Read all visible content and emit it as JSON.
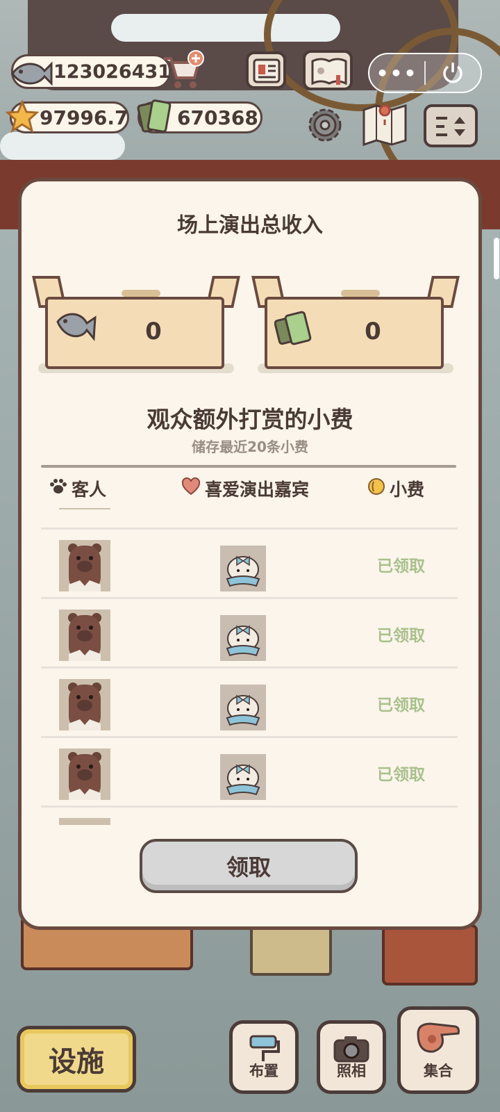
{
  "hud": {
    "fish_count": "123026431",
    "star_count": "97996.7",
    "ticket_count": "670368",
    "icons": [
      "fish-icon",
      "cart-plus-icon",
      "card-icon",
      "paw-book-icon",
      "more-icon",
      "power-icon",
      "star-icon",
      "ticket-icon",
      "gear-icon",
      "map-icon",
      "sort-icon"
    ]
  },
  "modal": {
    "title": "场上演出总收入",
    "fish_income": "0",
    "ticket_income": "0",
    "tips_title": "观众额外打赏的小费",
    "tips_note": "储存最近20条小费",
    "columns": {
      "guest": "客人",
      "favorite": "喜爱演出嘉宾",
      "tip": "小费"
    },
    "rows": [
      {
        "guest": "bear",
        "performer": "bunny-bow",
        "status": "已领取"
      },
      {
        "guest": "bear",
        "performer": "bunny-bow",
        "status": "已领取"
      },
      {
        "guest": "bear",
        "performer": "bunny-bow",
        "status": "已领取"
      },
      {
        "guest": "bear",
        "performer": "bunny-bow",
        "status": "已领取"
      }
    ],
    "claim_label": "领取"
  },
  "bottom": {
    "facility_label": "设施",
    "arrange_label": "布置",
    "photo_label": "照相",
    "gather_label": "集合"
  },
  "colors": {
    "panel_bg": "#fbf5eb",
    "panel_border": "#6a4a40",
    "claimed_text": "#a9c08c",
    "box_fill": "#f4ddb6"
  }
}
